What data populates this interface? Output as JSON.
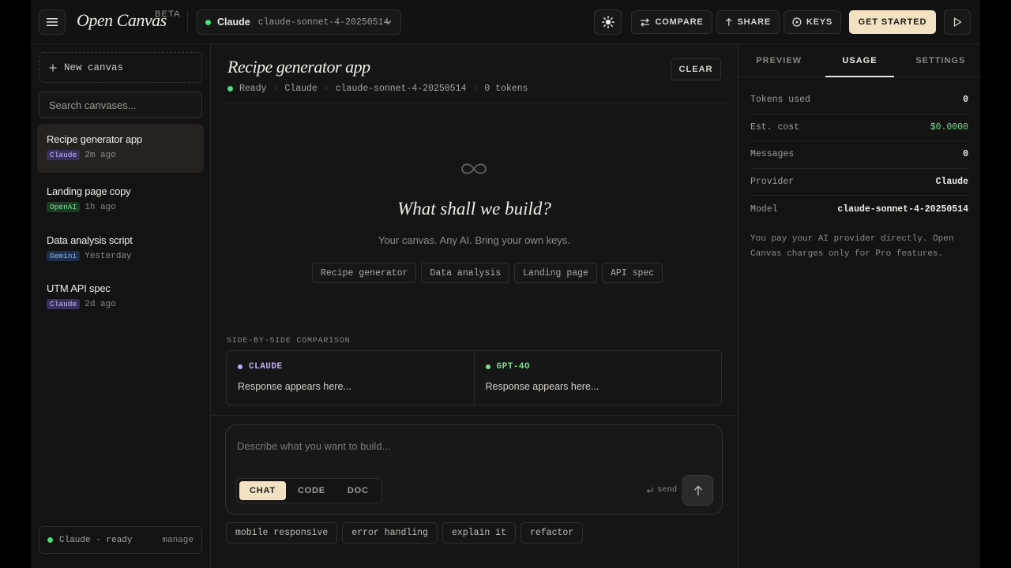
{
  "header": {
    "logo": "Open Canvas",
    "beta": "BETA",
    "model_provider": "Claude",
    "model_id": "claude-sonnet-4-20250514",
    "compare_label": "COMPARE",
    "share_label": "SHARE",
    "keys_label": "KEYS",
    "get_started_label": "GET STARTED"
  },
  "sidebar": {
    "new_canvas_label": "New canvas",
    "search_placeholder": "Search canvases...",
    "items": [
      {
        "title": "Recipe generator app",
        "badge": "Claude",
        "time": "2m ago"
      },
      {
        "title": "Landing page copy",
        "badge": "OpenAI",
        "time": "1h ago"
      },
      {
        "title": "Data analysis script",
        "badge": "Gemini",
        "time": "Yesterday"
      },
      {
        "title": "UTM API spec",
        "badge": "Claude",
        "time": "2d ago"
      }
    ],
    "status_text": "Claude - ready",
    "manage_label": "manage"
  },
  "main": {
    "title": "Recipe generator app",
    "clear_label": "CLEAR",
    "meta": {
      "status": "Ready",
      "provider": "Claude",
      "model": "claude-sonnet-4-20250514",
      "tokens": "0 tokens",
      "sep": "·"
    },
    "empty_title": "What shall we build?",
    "empty_subtitle": "Your canvas. Any AI. Bring your own keys.",
    "starter_chips": [
      "Recipe generator",
      "Data analysis",
      "Landing page",
      "API spec"
    ],
    "comparison_label": "SIDE-BY-SIDE COMPARISON",
    "comparison": [
      {
        "name": "CLAUDE",
        "response": "Response appears here..."
      },
      {
        "name": "GPT-4O",
        "response": "Response appears here..."
      }
    ],
    "prompt_placeholder": "Describe what you want to build...",
    "modes": [
      "CHAT",
      "CODE",
      "DOC"
    ],
    "send_hint": "send",
    "suggestions": [
      "mobile responsive",
      "error handling",
      "explain it",
      "refactor"
    ]
  },
  "right_panel": {
    "tabs": [
      "PREVIEW",
      "USAGE",
      "SETTINGS"
    ],
    "active_tab": "USAGE",
    "stats": [
      {
        "label": "Tokens used",
        "value": "0"
      },
      {
        "label": "Est. cost",
        "value": "$0.0000"
      },
      {
        "label": "Messages",
        "value": "0"
      },
      {
        "label": "Provider",
        "value": "Claude"
      },
      {
        "label": "Model",
        "value": "claude-sonnet-4-20250514"
      }
    ],
    "note": "You pay your AI provider directly. Open Canvas charges only for Pro features."
  },
  "colors": {
    "accent": "#f3e2c2",
    "status_green": "#4ade80",
    "claude_purple": "#c3aef5",
    "openai_green": "#7be08f",
    "gemini_blue": "#8bb6f0"
  },
  "icons": [
    "menu-icon",
    "chevron-down-icon",
    "sun-icon",
    "compare-arrows-icon",
    "upload-arrow-icon",
    "key-circle-icon",
    "play-icon",
    "plus-icon",
    "infinity-icon",
    "enter-key-icon",
    "arrow-up-icon"
  ]
}
